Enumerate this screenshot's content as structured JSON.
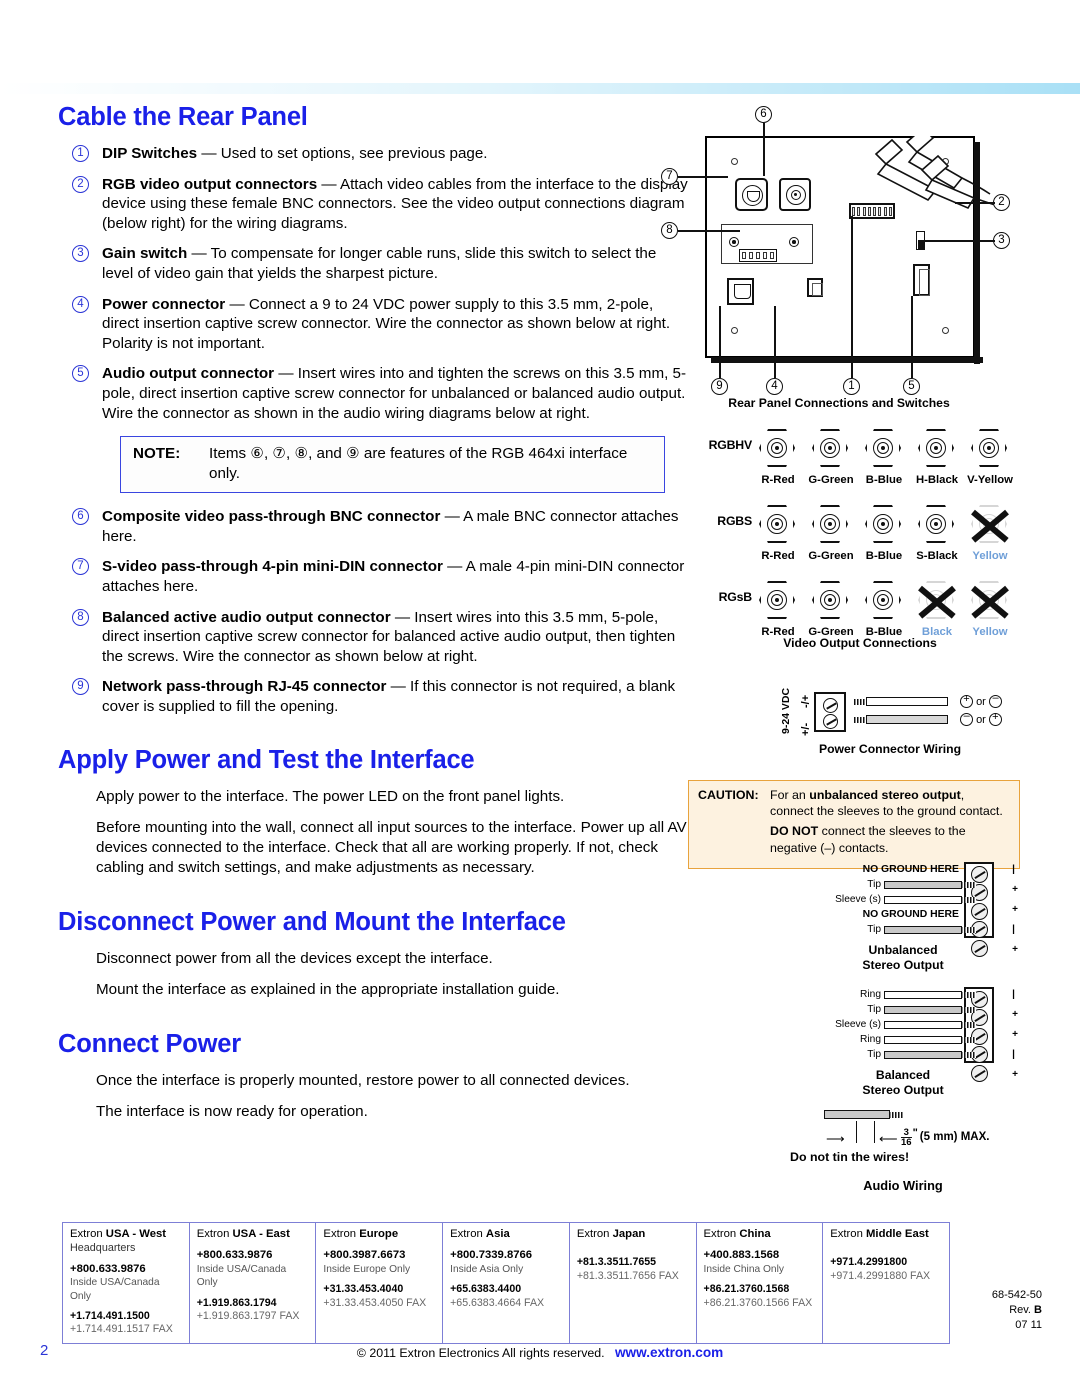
{
  "document": {
    "page_number": "2",
    "copyright": "© 2011 Extron Electronics  All rights reserved.",
    "url": "www.extron.com",
    "part_number": "68-542-50",
    "revision_prefix": "Rev. ",
    "revision": "B",
    "date_code": "07 11"
  },
  "sections": {
    "cable_rear_panel": {
      "heading": "Cable the Rear Panel",
      "items": [
        {
          "num": "1",
          "bold": "DIP Switches",
          "text": " — Used to set options, see previous page."
        },
        {
          "num": "2",
          "bold": "RGB video output connectors",
          "text": " — Attach video cables from the interface to the display device using these female BNC connectors. See the video output connections diagram (below right) for the wiring diagrams."
        },
        {
          "num": "3",
          "bold": "Gain switch",
          "text": " — To compensate for longer cable runs, slide this switch to select the level of video gain that yields the sharpest picture."
        },
        {
          "num": "4",
          "bold": "Power connector",
          "text": " — Connect a 9 to 24 VDC power supply to this 3.5 mm, 2-pole, direct insertion captive screw connector. Wire the connector as shown below at right. Polarity is not important."
        },
        {
          "num": "5",
          "bold": "Audio output connector",
          "text": " — Insert wires into and tighten the screws on this 3.5 mm, 5-pole, direct insertion captive screw connector for unbalanced or balanced audio output. Wire the connector as shown in the audio wiring diagrams below at right."
        }
      ],
      "note": {
        "label": "NOTE:",
        "text": "Items ⑥, ⑦, ⑧, and ⑨ are features of the RGB 464xi interface only."
      },
      "items2": [
        {
          "num": "6",
          "bold": "Composite video pass-through BNC connector",
          "text": " — A male BNC connector attaches here."
        },
        {
          "num": "7",
          "bold": "S-video pass-through 4-pin mini-DIN connector",
          "text": " — A male 4-pin mini-DIN connector attaches here."
        },
        {
          "num": "8",
          "bold": "Balanced active audio output connector",
          "text": " — Insert wires into this 3.5 mm, 5-pole, direct insertion captive screw connector for balanced active audio output, then tighten the screws. Wire the connector as shown below at right."
        },
        {
          "num": "9",
          "bold": "Network pass-through RJ-45 connector",
          "text": " — If this connector is not required, a blank cover is supplied to fill the opening."
        }
      ]
    },
    "apply_power": {
      "heading": "Apply Power and Test the Interface",
      "paragraphs": [
        "Apply power to the interface. The power LED on the front panel lights.",
        "Before mounting into the wall, connect all input sources to the interface. Power up all AV devices connected to the interface. Check that all are working properly. If not, check cabling and switch settings, and make adjustments as necessary."
      ]
    },
    "disconnect_power": {
      "heading": "Disconnect Power and Mount the Interface",
      "paragraphs": [
        "Disconnect power from all the devices except the interface.",
        "Mount the interface as explained in the appropriate installation guide."
      ]
    },
    "connect_power": {
      "heading": "Connect Power",
      "paragraphs": [
        "Once the interface is properly mounted, restore power to all connected devices.",
        "The interface is now ready for operation."
      ]
    }
  },
  "figures": {
    "rear_panel": {
      "caption": "Rear Panel Connections and Switches",
      "callouts": [
        "6",
        "7",
        "8",
        "9",
        "4",
        "1",
        "5",
        "2",
        "3"
      ]
    },
    "video_output": {
      "caption": "Video Output Connections",
      "rows": [
        {
          "label": "RGBHV",
          "pins": [
            {
              "text": "R-Red",
              "state": "on"
            },
            {
              "text": "G-Green",
              "state": "on"
            },
            {
              "text": "B-Blue",
              "state": "on"
            },
            {
              "text": "H-Black",
              "state": "on"
            },
            {
              "text": "V-Yellow",
              "state": "on"
            }
          ]
        },
        {
          "label": "RGBS",
          "pins": [
            {
              "text": "R-Red",
              "state": "on"
            },
            {
              "text": "G-Green",
              "state": "on"
            },
            {
              "text": "B-Blue",
              "state": "on"
            },
            {
              "text": "S-Black",
              "state": "on"
            },
            {
              "text": "Yellow",
              "state": "off"
            }
          ]
        },
        {
          "label": "RGsB",
          "pins": [
            {
              "text": "R-Red",
              "state": "on"
            },
            {
              "text": "G-Green",
              "state": "on"
            },
            {
              "text": "B-Blue",
              "state": "on"
            },
            {
              "text": "Black",
              "state": "off"
            },
            {
              "text": "Yellow",
              "state": "off"
            }
          ]
        }
      ]
    },
    "power_connector": {
      "caption": "Power Connector Wiring",
      "voltage_label": "9-24 VDC",
      "pin_top": "-/+",
      "pin_bottom": "+/-",
      "row1": "or",
      "row2": "or"
    },
    "caution": {
      "label": "CAUTION:",
      "line1_pre": "For an ",
      "line1_bold": "unbalanced stereo output",
      "line1_post": ", connect the sleeves to the ground contact.",
      "line2_bold": "DO NOT",
      "line2_post": " connect the sleeves to the negative (–) contacts."
    },
    "unbalanced": {
      "caption_line1": "Unbalanced",
      "caption_line2": "Stereo Output",
      "rows": [
        {
          "label": "NO GROUND HERE",
          "bold": true,
          "wire": false
        },
        {
          "label": "Tip",
          "bold": false,
          "wire": true,
          "fill": "grey"
        },
        {
          "label": "Sleeve (s)",
          "bold": false,
          "wire": true,
          "fill": "white"
        },
        {
          "label": "NO GROUND HERE",
          "bold": true,
          "wire": false
        },
        {
          "label": "Tip",
          "bold": false,
          "wire": true,
          "fill": "grey"
        }
      ],
      "pins": [
        "|",
        "+",
        "+",
        "|",
        "+"
      ]
    },
    "balanced": {
      "caption_line1": "Balanced",
      "caption_line2": "Stereo Output",
      "rows": [
        {
          "label": "Ring",
          "wire": true,
          "fill": "white"
        },
        {
          "label": "Tip",
          "wire": true,
          "fill": "grey"
        },
        {
          "label": "Sleeve (s)",
          "wire": true,
          "fill": "white"
        },
        {
          "label": "Ring",
          "wire": true,
          "fill": "white"
        },
        {
          "label": "Tip",
          "wire": true,
          "fill": "grey"
        }
      ],
      "pins": [
        "|",
        "+",
        "+",
        "|",
        "+"
      ]
    },
    "audio_wiring": {
      "caption": "Audio Wiring",
      "strip_numerator": "3",
      "strip_denominator": "16",
      "strip_unit": "\"",
      "strip_mm": "(5 mm) MAX.",
      "warning": "Do not tin the wires!"
    }
  },
  "contacts": [
    {
      "office_pre": "Extron ",
      "office_bold": "USA - West",
      "sub": "Headquarters",
      "toll": "+800.633.9876",
      "toll_note": "Inside USA/Canada Only",
      "phone": "+1.714.491.1500",
      "fax": "+1.714.491.1517",
      "fax_label": " FAX"
    },
    {
      "office_pre": "Extron ",
      "office_bold": "USA - East",
      "sub": "",
      "toll": "+800.633.9876",
      "toll_note": "Inside USA/Canada Only",
      "phone": "+1.919.863.1794",
      "fax": "+1.919.863.1797",
      "fax_label": " FAX"
    },
    {
      "office_pre": "Extron ",
      "office_bold": "Europe",
      "sub": "",
      "toll": "+800.3987.6673",
      "toll_note": "Inside Europe Only",
      "phone": "+31.33.453.4040",
      "fax": "+31.33.453.4050",
      "fax_label": " FAX"
    },
    {
      "office_pre": "Extron ",
      "office_bold": "Asia",
      "sub": "",
      "toll": "+800.7339.8766",
      "toll_note": "Inside Asia Only",
      "phone": "+65.6383.4400",
      "fax": "+65.6383.4664",
      "fax_label": " FAX"
    },
    {
      "office_pre": "Extron ",
      "office_bold": "Japan",
      "sub": "",
      "toll": "+81.3.3511.7655",
      "toll_note": "",
      "phone": "+81.3.3511.7656",
      "fax": "",
      "fax_label": " FAX"
    },
    {
      "office_pre": "Extron ",
      "office_bold": "China",
      "sub": "",
      "toll": "+400.883.1568",
      "toll_note": "Inside China Only",
      "phone": "+86.21.3760.1568",
      "fax": "+86.21.3760.1566",
      "fax_label": " FAX"
    },
    {
      "office_pre": "Extron ",
      "office_bold": "Middle East",
      "sub": "",
      "toll": "+971.4.2991800",
      "toll_note": "",
      "phone": "+971.4.2991880",
      "fax": "",
      "fax_label": " FAX"
    }
  ],
  "colors": {
    "heading_blue": "#1a20e8",
    "callout_blue": "#2b35d6",
    "caution_border": "#e8a33d",
    "caution_bg": "#fdf2e0",
    "table_border": "#7d7fd6"
  }
}
